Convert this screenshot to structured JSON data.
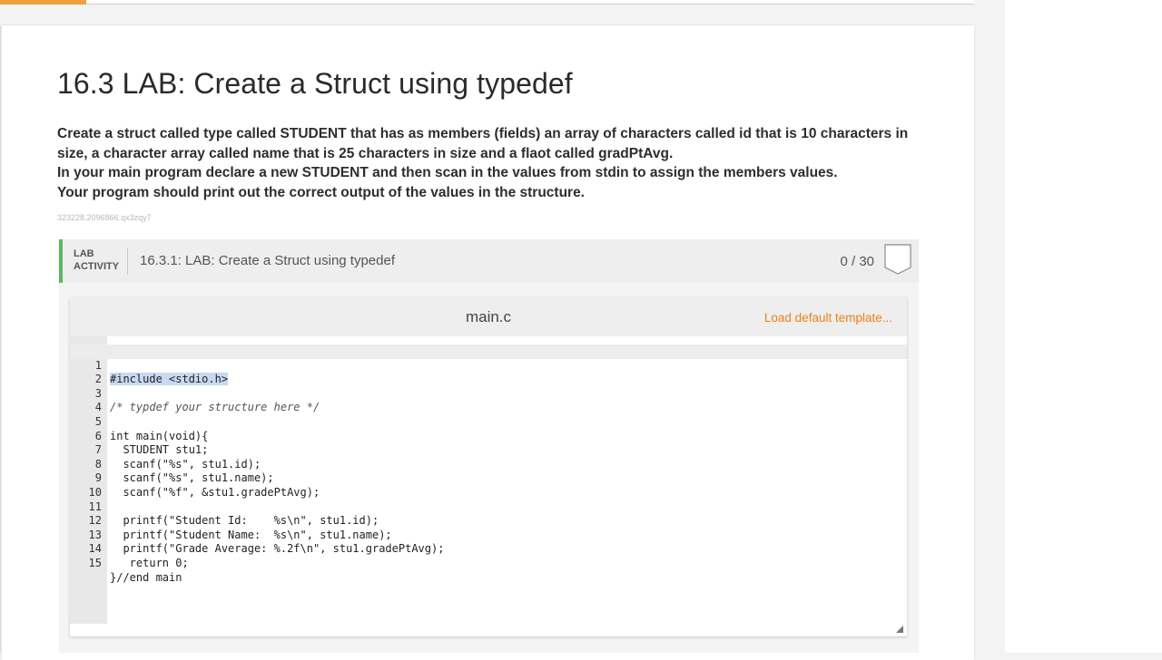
{
  "page": {
    "title": "16.3 LAB: Create a Struct using typedef",
    "description": [
      "Create a struct called type called STUDENT that has as members (fields) an array of characters called id that is 10 characters in size, a character array called name that is 25 characters in size and a flaot called gradPtAvg.",
      "In your main program declare a new STUDENT and then scan in the values from stdin to assign the members values.",
      "Your program should print out the correct output of the values in the structure."
    ],
    "small_id": "323228.2096866.qx3zqy7"
  },
  "lab": {
    "tag_line1": "LAB",
    "tag_line2": "ACTIVITY",
    "title": "16.3.1: LAB: Create a Struct using typedef",
    "score": "0 / 30"
  },
  "editor": {
    "filename": "main.c",
    "load_template": "Load default template...",
    "code": [
      {
        "n": "1",
        "t": "#include <stdio.h>"
      },
      {
        "n": "2",
        "t": ""
      },
      {
        "n": "3",
        "t": "/* typdef your structure here */"
      },
      {
        "n": "4",
        "t": ""
      },
      {
        "n": "5",
        "t": "int main(void){"
      },
      {
        "n": "6",
        "t": "  STUDENT stu1;"
      },
      {
        "n": "7",
        "t": "  scanf(\"%s\", stu1.id);"
      },
      {
        "n": "8",
        "t": "  scanf(\"%s\", stu1.name);"
      },
      {
        "n": "9",
        "t": "  scanf(\"%f\", &stu1.gradePtAvg);"
      },
      {
        "n": "10",
        "t": ""
      },
      {
        "n": "11",
        "t": "  printf(\"Student Id:    %s\\n\", stu1.id);"
      },
      {
        "n": "12",
        "t": "  printf(\"Student Name:  %s\\n\", stu1.name);"
      },
      {
        "n": "13",
        "t": "  printf(\"Grade Average: %.2f\\n\", stu1.gradePtAvg);"
      },
      {
        "n": "14",
        "t": "   return 0;"
      },
      {
        "n": "15",
        "t": "}//end main"
      }
    ]
  },
  "colors": {
    "accent_orange": "#e8811a",
    "lab_green": "#5cb85c",
    "selection": "#c9d9f2"
  }
}
